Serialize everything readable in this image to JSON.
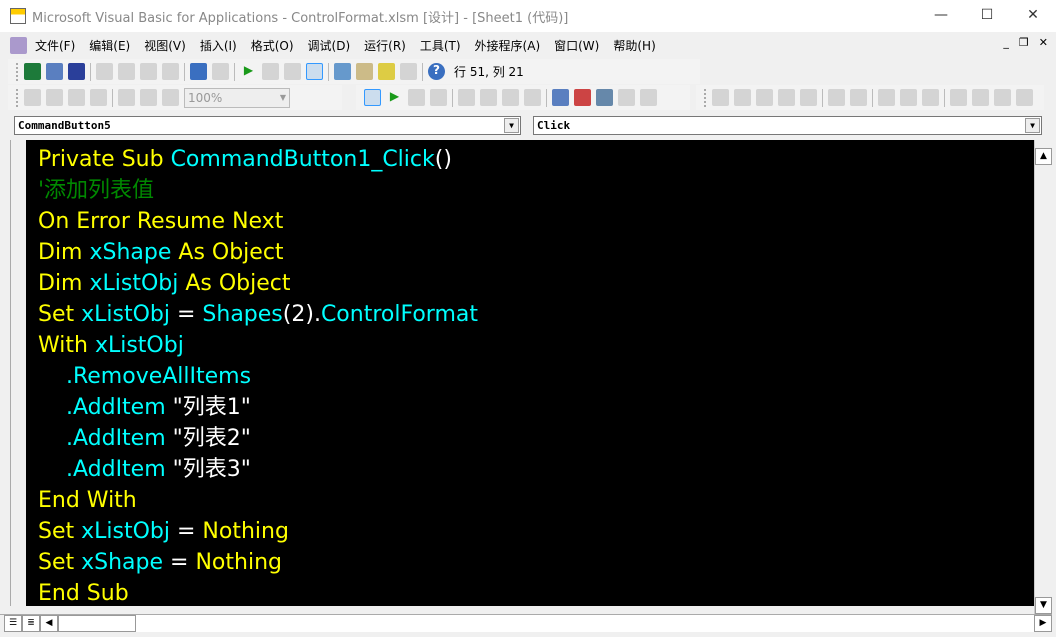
{
  "window": {
    "title": "Microsoft Visual Basic for Applications - ControlFormat.xlsm [设计] - [Sheet1 (代码)]",
    "minimize": "—",
    "maximize": "☐",
    "close": "✕"
  },
  "menu": [
    "文件(F)",
    "编辑(E)",
    "视图(V)",
    "插入(I)",
    "格式(O)",
    "调试(D)",
    "运行(R)",
    "工具(T)",
    "外接程序(A)",
    "窗口(W)",
    "帮助(H)"
  ],
  "mdi": {
    "minimize": "_",
    "restore": "❐",
    "close": "✕"
  },
  "toolbar": {
    "position": "行 51, 列 21",
    "zoom": "100%"
  },
  "object_combo": "CommandButton5",
  "proc_combo": "Click",
  "code_lines": [
    [
      [
        "k",
        "Private Sub "
      ],
      [
        "i",
        "CommandButton1_Click"
      ],
      [
        "w",
        "()"
      ]
    ],
    [
      [
        "c",
        "'添加列表值"
      ]
    ],
    [
      [
        "k",
        "On Error Resume Next"
      ]
    ],
    [
      [
        "k",
        "Dim "
      ],
      [
        "i",
        "xShape"
      ],
      [
        "k",
        " As Object"
      ]
    ],
    [
      [
        "k",
        "Dim "
      ],
      [
        "i",
        "xListObj"
      ],
      [
        "k",
        " As Object"
      ]
    ],
    [
      [
        "k",
        "Set "
      ],
      [
        "i",
        "xListObj"
      ],
      [
        "w",
        " = "
      ],
      [
        "i",
        "Shapes"
      ],
      [
        "w",
        "(2)."
      ],
      [
        "i",
        "ControlFormat"
      ]
    ],
    [
      [
        "k",
        "With "
      ],
      [
        "i",
        "xListObj"
      ]
    ],
    [
      [
        "w",
        "    "
      ],
      [
        "i",
        ".RemoveAllItems"
      ]
    ],
    [
      [
        "w",
        "    "
      ],
      [
        "i",
        ".AddItem"
      ],
      [
        "w",
        " \"列表1\""
      ]
    ],
    [
      [
        "w",
        "    "
      ],
      [
        "i",
        ".AddItem"
      ],
      [
        "w",
        " \"列表2\""
      ]
    ],
    [
      [
        "w",
        "    "
      ],
      [
        "i",
        ".AddItem"
      ],
      [
        "w",
        " \"列表3\""
      ]
    ],
    [
      [
        "k",
        "End With"
      ]
    ],
    [
      [
        "k",
        "Set "
      ],
      [
        "i",
        "xListObj"
      ],
      [
        "w",
        " = "
      ],
      [
        "k",
        "Nothing"
      ]
    ],
    [
      [
        "k",
        "Set "
      ],
      [
        "i",
        "xShape"
      ],
      [
        "w",
        " = "
      ],
      [
        "k",
        "Nothing"
      ]
    ],
    [
      [
        "k",
        "End Sub"
      ]
    ]
  ],
  "colors": {
    "keyword": "#ffff00",
    "identifier": "#00ffff",
    "comment": "#008000",
    "text": "#ffffff",
    "background": "#000000"
  }
}
